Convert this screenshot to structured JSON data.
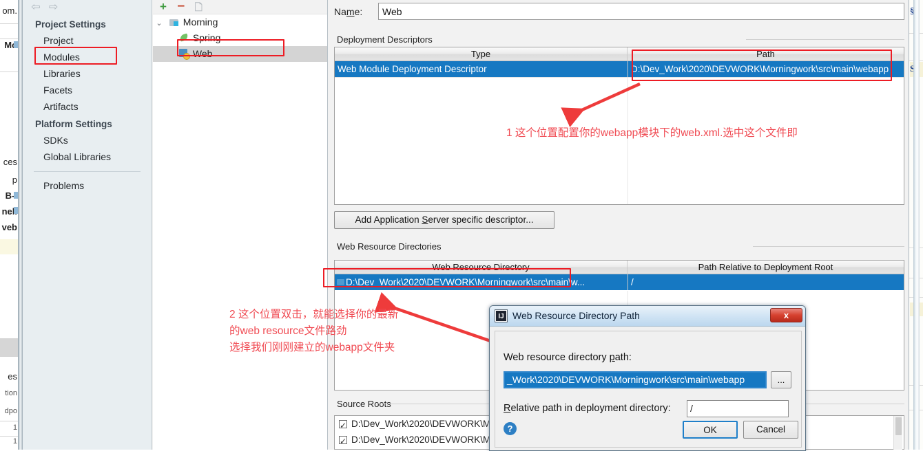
{
  "background_left": {
    "fragments": [
      "om.",
      "Mo",
      "ces",
      "p",
      "B-I",
      "nell",
      "veb",
      "es",
      "tion",
      "dpo",
      "1",
      "1"
    ]
  },
  "background_right": {
    "fragment": "S"
  },
  "sidebar": {
    "nav": {
      "back_icon": "arrow-left-icon",
      "forward_icon": "arrow-right-icon"
    },
    "groups": [
      {
        "title": "Project Settings",
        "items": [
          {
            "label": "Project"
          },
          {
            "label": "Modules",
            "highlighted": true
          },
          {
            "label": "Libraries"
          },
          {
            "label": "Facets"
          },
          {
            "label": "Artifacts"
          }
        ]
      },
      {
        "title": "Platform Settings",
        "items": [
          {
            "label": "SDKs"
          },
          {
            "label": "Global Libraries"
          }
        ]
      }
    ],
    "problems_label": "Problems"
  },
  "module_tree": {
    "toolbar": {
      "add": "+",
      "remove": "−",
      "copy": "copy-icon"
    },
    "nodes": [
      {
        "label": "Morning",
        "icon": "module-folder-icon",
        "level": 1,
        "expanded": true
      },
      {
        "label": "Spring",
        "icon": "spring-leaf-icon",
        "level": 2
      },
      {
        "label": "Web",
        "icon": "web-facet-icon",
        "level": 2,
        "selected": true,
        "highlighted": true
      }
    ]
  },
  "content": {
    "name_label_pre": "Na",
    "name_label_accel": "m",
    "name_label_post": "e:",
    "name_value": "Web",
    "deployment_descriptors": {
      "group_label": "Deployment Descriptors",
      "columns": [
        "Type",
        "Path"
      ],
      "rows": [
        {
          "type": "Web Module Deployment Descriptor",
          "path": "D:\\Dev_Work\\2020\\DEVWORK\\Morningwork\\src\\main\\webapp",
          "selected": true
        }
      ],
      "tools": {
        "add": "+",
        "remove": "−",
        "edit": "pencil-icon"
      }
    },
    "add_server_descriptor_button": {
      "pre": "Add Application ",
      "accel": "S",
      "post": "erver specific descriptor..."
    },
    "web_resource_directories": {
      "group_label": "Web Resource Directories",
      "columns": [
        "Web Resource Directory",
        "Path Relative to Deployment Root"
      ],
      "rows": [
        {
          "directory": "D:\\Dev_Work\\2020\\DEVWORK\\Morningwork\\src\\main\\w...",
          "relative": "/",
          "selected": true
        }
      ],
      "tools": {
        "add": "+",
        "remove": "−",
        "edit": "pencil-icon",
        "help": "?"
      }
    },
    "source_roots": {
      "group_label": "Source Roots",
      "rows": [
        {
          "path": "D:\\Dev_Work\\2020\\DEVWORK\\Mo",
          "checked": true
        },
        {
          "path": "D:\\Dev_Work\\2020\\DEVWORK\\Mo",
          "checked": true
        }
      ]
    }
  },
  "annotations": [
    {
      "id": "note-1",
      "text": "1 这个位置配置你的webapp模块下的web.xml.选中这个文件即"
    },
    {
      "id": "note-2-line-1",
      "text": "2 这个位置双击，就能选择你的最新"
    },
    {
      "id": "note-2-line-2",
      "text": "的web resource文件路劲"
    },
    {
      "id": "note-2-line-3",
      "text": "选择我们刚刚建立的webapp文件夹"
    }
  ],
  "dialog": {
    "title": "Web Resource Directory Path",
    "app_icon": "IJ",
    "close_icon": "x",
    "path_label_pre": "Web resource directory ",
    "path_label_accel": "p",
    "path_label_post": "ath:",
    "path_value": "_Work\\2020\\DEVWORK\\Morningwork\\src\\main\\webapp",
    "browse_label": "...",
    "relative_label_accel": "R",
    "relative_label_post": "elative path in deployment directory:",
    "relative_value": "/",
    "help_icon": "?",
    "ok_label": "OK",
    "cancel_label": "Cancel"
  },
  "colors": {
    "accent_red": "#ed1c24",
    "note_red": "#f04a52",
    "selection_blue": "#1678c2",
    "sidebar_bg": "#e8eef1",
    "panel_bg": "#f2f2f2"
  }
}
